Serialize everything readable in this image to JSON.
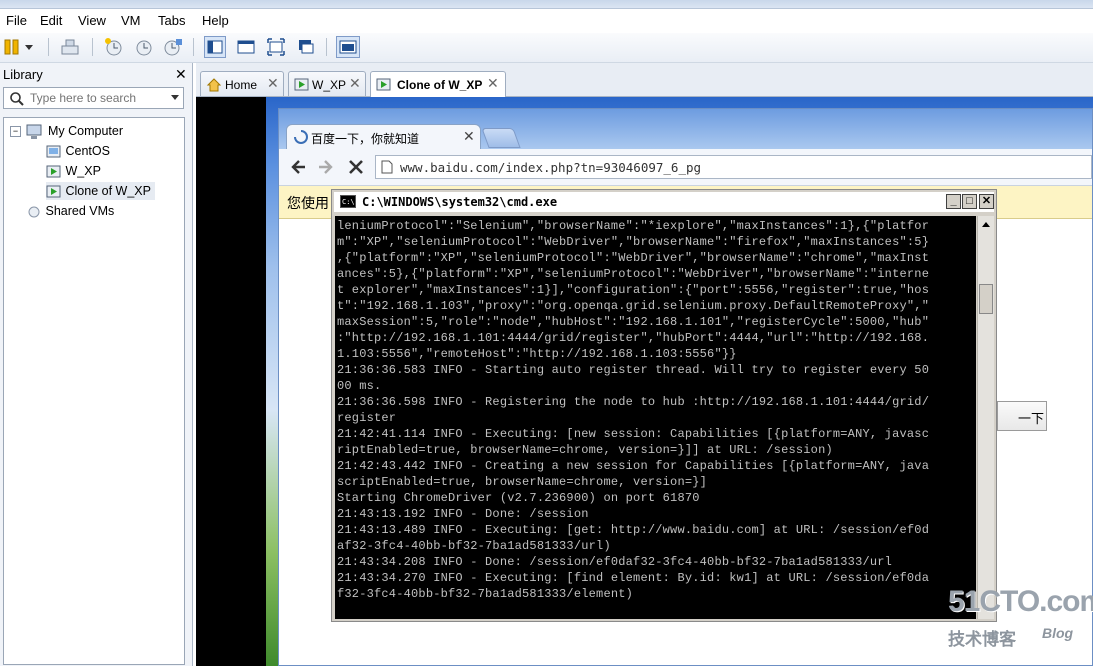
{
  "menubar": {
    "items": [
      "File",
      "Edit",
      "View",
      "VM",
      "Tabs",
      "Help"
    ]
  },
  "toolbar": {
    "icons": [
      "pause-icon",
      "dropdown-arrow-icon",
      "send-ctrl-alt-del-icon",
      "snapshot-take-icon",
      "snapshot-revert-icon",
      "snapshot-manager-icon",
      "view-sidebar-icon",
      "view-console-icon",
      "fullscreen-icon",
      "unity-icon",
      "view-tabs-icon"
    ]
  },
  "library": {
    "title": "Library",
    "search_placeholder": "Type here to search",
    "tree": {
      "root": "My Computer",
      "children": [
        "CentOS",
        "W_XP",
        "Clone of W_XP"
      ],
      "shared": "Shared VMs"
    }
  },
  "tabs": [
    {
      "label": "Home"
    },
    {
      "label": "W_XP"
    },
    {
      "label": "Clone of W_XP"
    }
  ],
  "browser": {
    "tab_title": "百度一下，你就知道",
    "url": "www.baidu.com/index.php?tn=93046097_6_pg",
    "info_text": "您使用",
    "button_fragment": "一下"
  },
  "cmd": {
    "title": "C:\\WINDOWS\\system32\\cmd.exe",
    "lines": [
      "leniumProtocol\":\"Selenium\",\"browserName\":\"*iexplore\",\"maxInstances\":1},{\"platfor",
      "m\":\"XP\",\"seleniumProtocol\":\"WebDriver\",\"browserName\":\"firefox\",\"maxInstances\":5}",
      ",{\"platform\":\"XP\",\"seleniumProtocol\":\"WebDriver\",\"browserName\":\"chrome\",\"maxInst",
      "ances\":5},{\"platform\":\"XP\",\"seleniumProtocol\":\"WebDriver\",\"browserName\":\"interne",
      "t explorer\",\"maxInstances\":1}],\"configuration\":{\"port\":5556,\"register\":true,\"hos",
      "t\":\"192.168.1.103\",\"proxy\":\"org.openqa.grid.selenium.proxy.DefaultRemoteProxy\",\"",
      "maxSession\":5,\"role\":\"node\",\"hubHost\":\"192.168.1.101\",\"registerCycle\":5000,\"hub\"",
      ":\"http://192.168.1.101:4444/grid/register\",\"hubPort\":4444,\"url\":\"http://192.168.",
      "1.103:5556\",\"remoteHost\":\"http://192.168.1.103:5556\"}}",
      "21:36:36.583 INFO - Starting auto register thread. Will try to register every 50",
      "00 ms.",
      "21:36:36.598 INFO - Registering the node to hub :http://192.168.1.101:4444/grid/",
      "register",
      "21:42:41.114 INFO - Executing: [new session: Capabilities [{platform=ANY, javasc",
      "riptEnabled=true, browserName=chrome, version=}]] at URL: /session)",
      "21:42:43.442 INFO - Creating a new session for Capabilities [{platform=ANY, java",
      "scriptEnabled=true, browserName=chrome, version=}]",
      "Starting ChromeDriver (v2.7.236900) on port 61870",
      "21:43:13.192 INFO - Done: /session",
      "21:43:13.489 INFO - Executing: [get: http://www.baidu.com] at URL: /session/ef0d",
      "af32-3fc4-40bb-bf32-7ba1ad581333/url)",
      "21:43:34.208 INFO - Done: /session/ef0daf32-3fc4-40bb-bf32-7ba1ad581333/url",
      "21:43:34.270 INFO - Executing: [find element: By.id: kw1] at URL: /session/ef0da",
      "f32-3fc4-40bb-bf32-7ba1ad581333/element)"
    ]
  },
  "watermark": {
    "logo": "51CTO.com",
    "subtitle": "技术博客",
    "blog": "Blog"
  }
}
